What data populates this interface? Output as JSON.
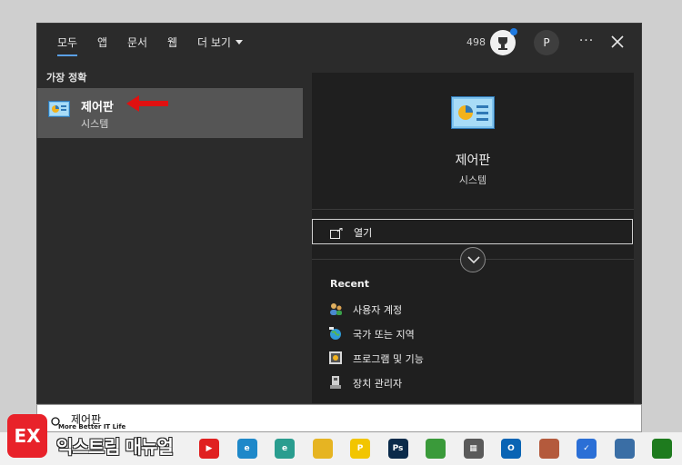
{
  "header": {
    "tabs": [
      {
        "label": "모두",
        "active": true
      },
      {
        "label": "앱"
      },
      {
        "label": "문서"
      },
      {
        "label": "웹"
      },
      {
        "label": "더 보기"
      }
    ],
    "points": "498",
    "avatar_initial": "P",
    "more_icon": "ellipsis-icon",
    "close_icon": "close-icon"
  },
  "best_match": {
    "section_label": "가장 정확",
    "title": "제어판",
    "subtitle": "시스템",
    "annotation_color": "#e01010"
  },
  "detail": {
    "title": "제어판",
    "subtitle": "시스템",
    "open_label": "열기",
    "recent_label": "Recent",
    "recent_items": [
      {
        "label": "사용자 계정",
        "icon": "user-accounts-icon"
      },
      {
        "label": "국가 또는 지역",
        "icon": "region-icon"
      },
      {
        "label": "프로그램 및 기능",
        "icon": "programs-icon"
      },
      {
        "label": "장치 관리자",
        "icon": "device-manager-icon"
      }
    ]
  },
  "search": {
    "value": "제어판"
  },
  "watermark": {
    "logo": "EX",
    "tagline": "More Better IT Life",
    "title": "익스트림 매뉴얼"
  },
  "taskbar": {
    "apps": [
      {
        "name": "youtube-music-icon",
        "color": "#e02020",
        "label": "▶"
      },
      {
        "name": "edge-icon",
        "color": "#1e88c9",
        "label": "e"
      },
      {
        "name": "edge-dev-icon",
        "color": "#2a9d8f",
        "label": "e"
      },
      {
        "name": "file-explorer-icon",
        "color": "#e6b422",
        "label": ""
      },
      {
        "name": "potplayer-icon",
        "color": "#f2c500",
        "label": "P"
      },
      {
        "name": "photoshop-icon",
        "color": "#0a2a4a",
        "label": "Ps"
      },
      {
        "name": "notepad-icon",
        "color": "#3a9a3a",
        "label": ""
      },
      {
        "name": "calculator-icon",
        "color": "#5a5a5a",
        "label": "▦"
      },
      {
        "name": "outlook-icon",
        "color": "#0a64b4",
        "label": "O"
      },
      {
        "name": "sourcetree-icon",
        "color": "#b45a3c",
        "label": ""
      },
      {
        "name": "todo-icon",
        "color": "#2b6fd6",
        "label": "✓"
      },
      {
        "name": "virtualbox-icon",
        "color": "#3a6ea5",
        "label": ""
      },
      {
        "name": "xbox-icon",
        "color": "#1e7b1e",
        "label": ""
      }
    ]
  }
}
